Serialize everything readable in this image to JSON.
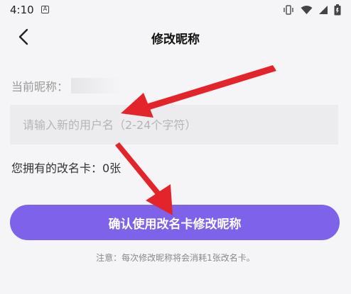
{
  "status_bar": {
    "time": "4:10",
    "notif_letter": "A"
  },
  "header": {
    "title": "修改昵称"
  },
  "form": {
    "current_label": "当前昵称：",
    "input_placeholder": "请输入新的用户名（2-24个字符）",
    "input_value": "",
    "card_count_text": "您拥有的改名卡：0张"
  },
  "confirm": {
    "label": "确认使用改名卡修改昵称"
  },
  "notice": {
    "text": "注意：每次修改昵称将会消耗1张改名卡。"
  },
  "colors": {
    "accent": "#7e62ea",
    "arrow": "#e3242b",
    "background": "#f5f5f7"
  },
  "icons": [
    "vibrate-icon",
    "wifi-icon",
    "signal-icon",
    "battery-icon",
    "back-arrow-icon"
  ]
}
